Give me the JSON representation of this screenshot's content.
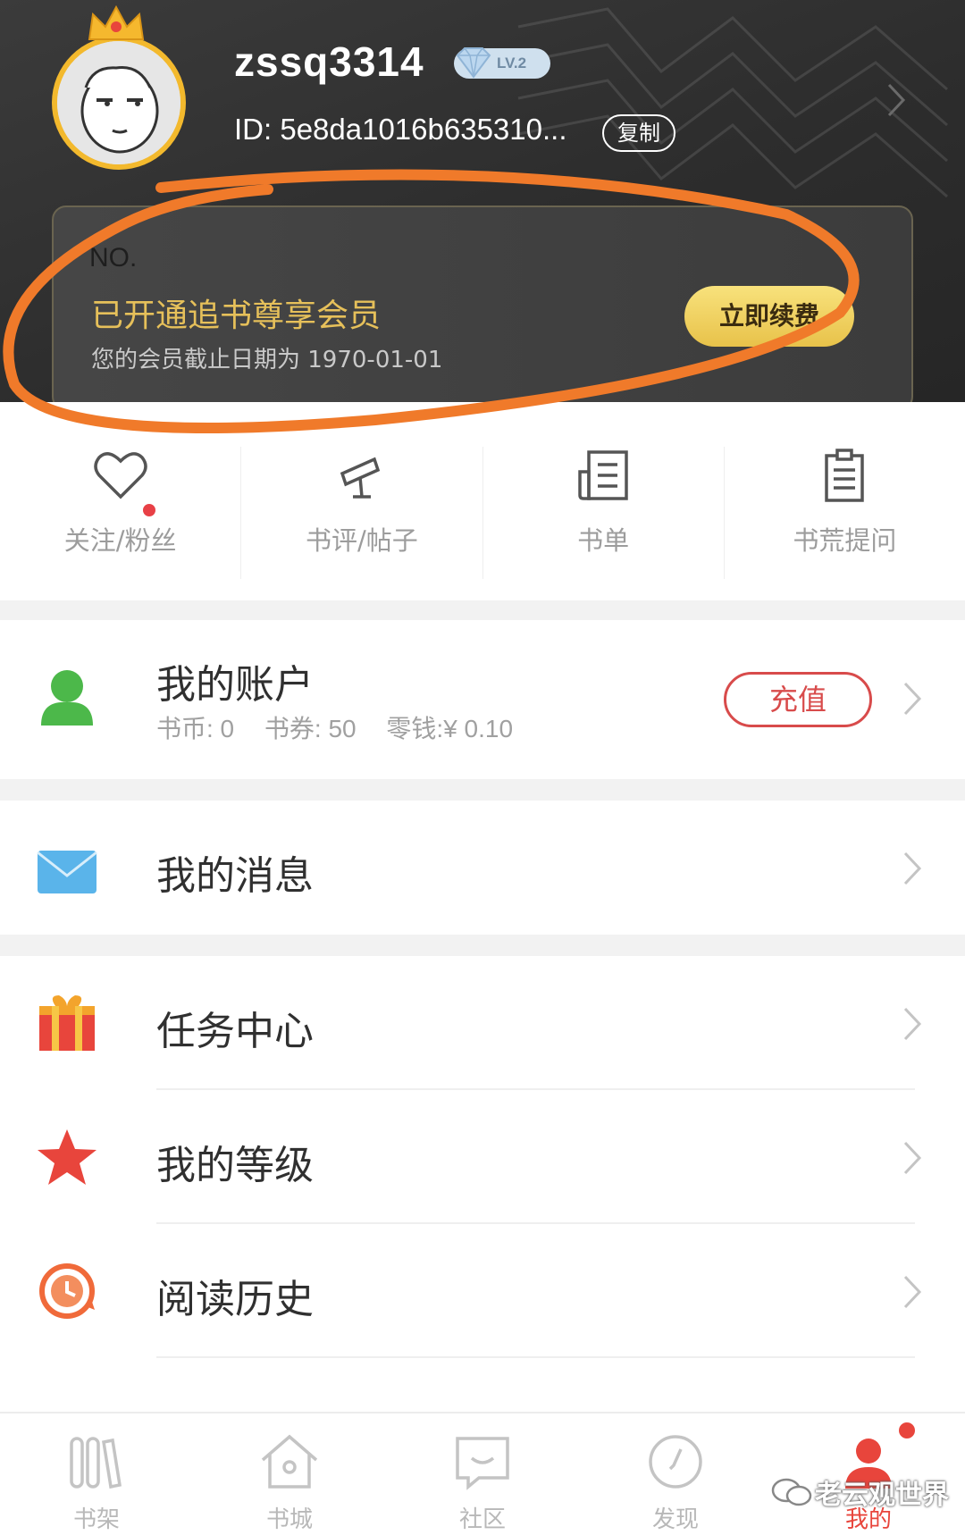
{
  "profile": {
    "username": "zssq3314",
    "level": "LV.2",
    "user_id": "ID: 5e8da1016b635310...",
    "copy_label": "复制"
  },
  "vip": {
    "no_label": "NO.",
    "title": "已开通追书尊享会员",
    "expire_text": "您的会员截止日期为  1970-01-01",
    "renew_label": "立即续费"
  },
  "quick_links": [
    {
      "label": "关注/粉丝",
      "icon": "heart-icon",
      "badge_dot": true
    },
    {
      "label": "书评/帖子",
      "icon": "megaphone-icon"
    },
    {
      "label": "书单",
      "icon": "booklist-icon"
    },
    {
      "label": "书荒提问",
      "icon": "clipboard-icon"
    }
  ],
  "account": {
    "title": "我的账户",
    "coins": "书币: 0",
    "vouchers": "书券: 50",
    "change": "零钱:¥ 0.10",
    "recharge_label": "充值"
  },
  "menu": {
    "messages": "我的消息",
    "tasks": "任务中心",
    "level": "我的等级",
    "history": "阅读历史"
  },
  "bottom_nav": [
    {
      "label": "书架",
      "icon": "bookshelf-icon"
    },
    {
      "label": "书城",
      "icon": "home-icon"
    },
    {
      "label": "社区",
      "icon": "chat-icon"
    },
    {
      "label": "发现",
      "icon": "compass-icon"
    },
    {
      "label": "我的",
      "icon": "profile-icon",
      "active": true
    }
  ],
  "watermark": "老云观世界",
  "colors": {
    "accent": "#e8453c",
    "vip_gold": "#e6c05a",
    "header_bg": "#2d2d2d",
    "annotation": "#f07a2a"
  }
}
